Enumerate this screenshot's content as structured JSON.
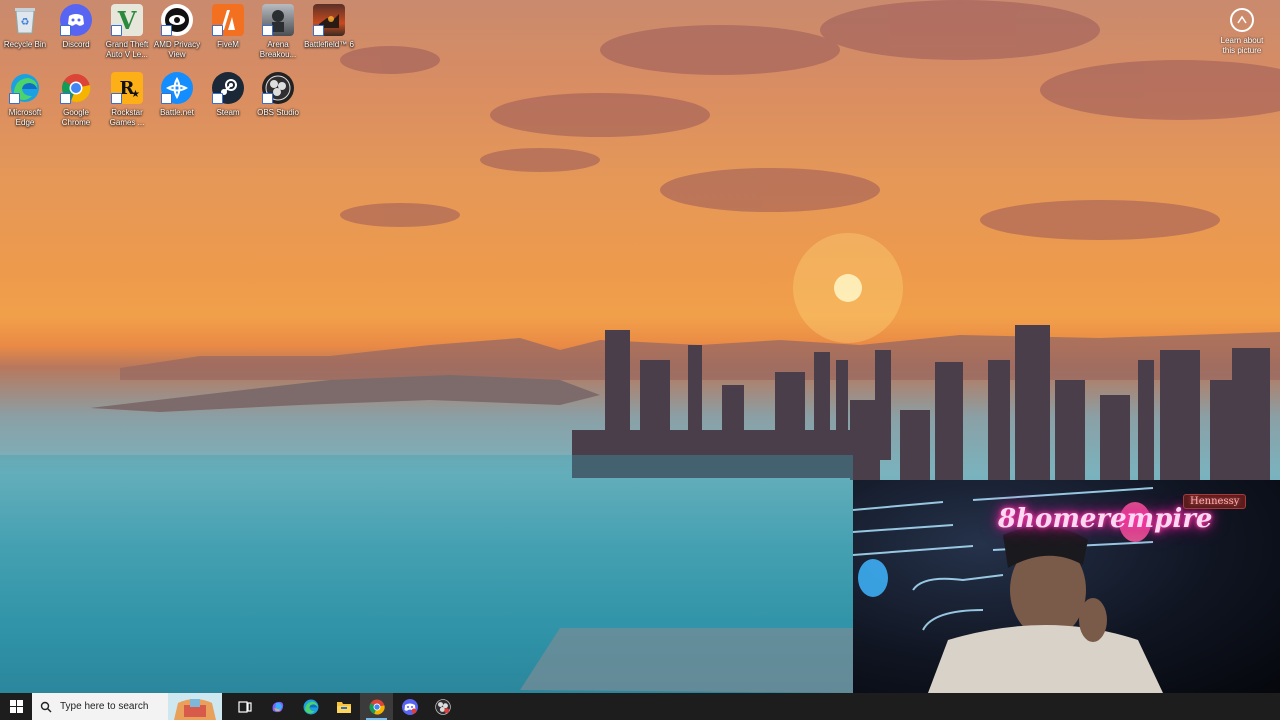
{
  "desktop": {
    "icons": [
      {
        "label": "Recycle Bin",
        "icon": "recycle-bin-icon"
      },
      {
        "label": "Discord",
        "icon": "discord-icon"
      },
      {
        "label": "Grand Theft Auto V Le...",
        "icon": "gta-v-icon"
      },
      {
        "label": "AMD Privacy View",
        "icon": "amd-privacy-view-icon"
      },
      {
        "label": "FiveM",
        "icon": "fivem-icon"
      },
      {
        "label": "Arena Breakou...",
        "icon": "arena-breakout-icon"
      },
      {
        "label": "Battlefield™ 6",
        "icon": "battlefield-icon"
      },
      {
        "label": "Microsoft Edge",
        "icon": "edge-icon"
      },
      {
        "label": "Google Chrome",
        "icon": "chrome-icon"
      },
      {
        "label": "Rockstar Games ...",
        "icon": "rockstar-icon"
      },
      {
        "label": "Battle.net",
        "icon": "battlenet-icon"
      },
      {
        "label": "Steam",
        "icon": "steam-icon"
      },
      {
        "label": "OBS Studio",
        "icon": "obs-icon"
      }
    ],
    "learn_about": "Learn about this picture"
  },
  "webcam": {
    "neon_text": "Hennessy",
    "neon_main": "8homerempire"
  },
  "taskbar": {
    "search_placeholder": "Type here to search",
    "buttons": [
      "task-view-icon",
      "copilot-icon",
      "edge-icon",
      "file-explorer-icon",
      "chrome-icon",
      "discord-icon",
      "obs-icon"
    ],
    "active": "chrome-icon",
    "accent": "#76b9ed"
  }
}
